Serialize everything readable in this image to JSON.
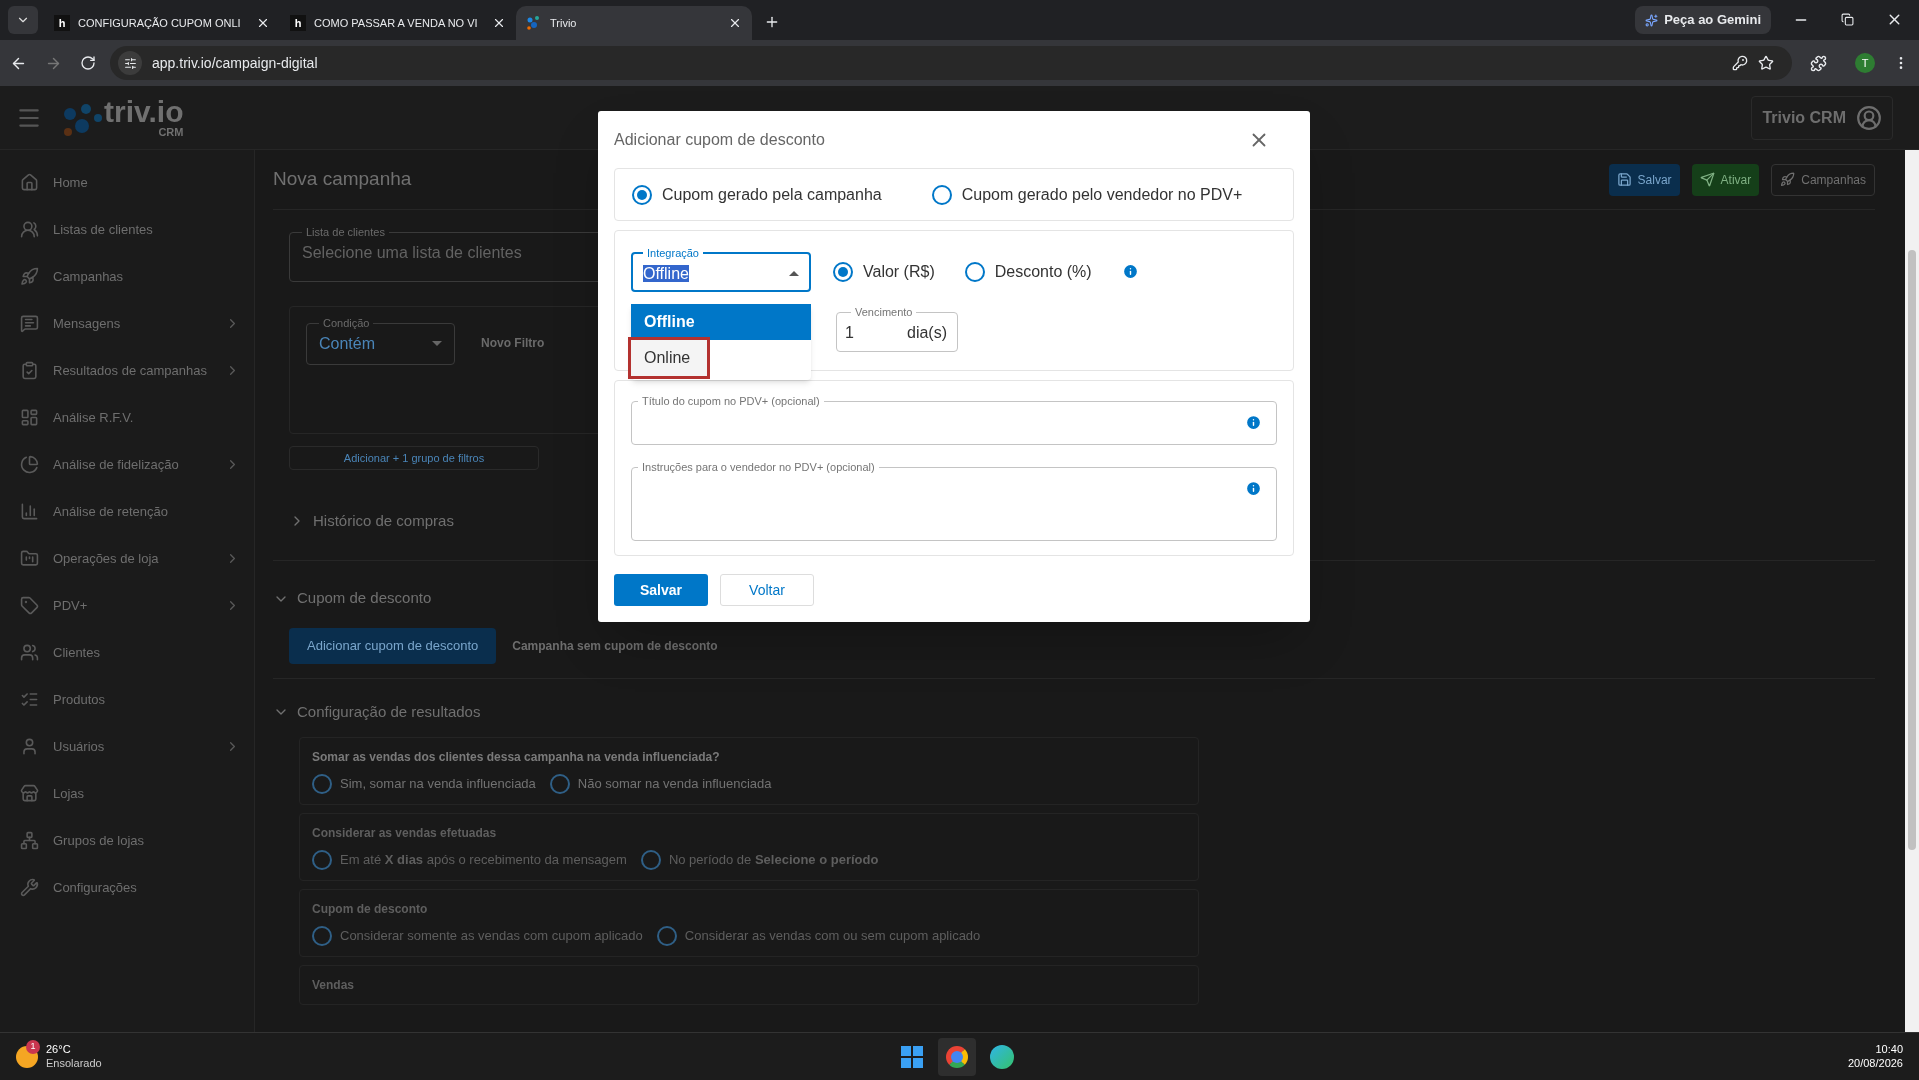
{
  "browser": {
    "tabs": [
      {
        "title": "CONFIGURAÇÃO CUPOM ONLI",
        "icon": "h",
        "selected": false
      },
      {
        "title": "COMO PASSAR A VENDA NO VI",
        "icon": "h",
        "selected": false
      },
      {
        "title": "Trivio",
        "selected": true
      }
    ],
    "url": "app.triv.io/campaign-digital",
    "gemini_button": "Peça ao Gemini",
    "profile_initial": "T"
  },
  "header": {
    "logo_text": "triv.io",
    "logo_sub": "CRM",
    "user_menu": "Trivio CRM"
  },
  "sidebar": {
    "items": [
      {
        "label": "Home",
        "expandable": false
      },
      {
        "label": "Listas de clientes",
        "expandable": false
      },
      {
        "label": "Campanhas",
        "expandable": false
      },
      {
        "label": "Mensagens",
        "expandable": true
      },
      {
        "label": "Resultados de campanhas",
        "expandable": true
      },
      {
        "label": "Análise R.F.V.",
        "expandable": false
      },
      {
        "label": "Análise de fidelização",
        "expandable": true
      },
      {
        "label": "Análise de retenção",
        "expandable": false
      },
      {
        "label": "Operações de loja",
        "expandable": true
      },
      {
        "label": "PDV+",
        "expandable": true
      },
      {
        "label": "Clientes",
        "expandable": false
      },
      {
        "label": "Produtos",
        "expandable": false
      },
      {
        "label": "Usuários",
        "expandable": true
      },
      {
        "label": "Lojas",
        "expandable": false
      },
      {
        "label": "Grupos de lojas",
        "expandable": false
      },
      {
        "label": "Configurações",
        "expandable": false
      }
    ]
  },
  "page": {
    "title": "Nova campanha",
    "actions": [
      {
        "label": "Salvar",
        "kind": "save"
      },
      {
        "label": "Ativar",
        "kind": "activate"
      },
      {
        "label": "Campanhas",
        "kind": "campaigns"
      }
    ],
    "client_list": {
      "label": "Lista de clientes",
      "placeholder": "Selecione uma lista de clientes"
    },
    "condition": {
      "label": "Condição",
      "value": "Contém"
    },
    "new_filter": "Novo Filtro",
    "add_group": "Adicionar + 1 grupo de filtros",
    "purchase_history": {
      "title": "Histórico de compras",
      "expanded": false
    },
    "coupon_section": {
      "title": "Cupom de desconto",
      "expanded": true,
      "add_button": "Adicionar cupom de desconto",
      "note": "Campanha sem cupom de desconto"
    },
    "results_section": {
      "title": "Configuração de resultados",
      "expanded": true,
      "groups": [
        {
          "title": "Somar as vendas dos clientes dessa campanha na venda influenciada?",
          "disabled": false,
          "options": [
            {
              "label": "Sim, somar na venda influenciada",
              "selected": false
            },
            {
              "label": "Não somar na venda influenciada",
              "selected": false
            }
          ]
        },
        {
          "title": "Considerar as vendas efetuadas",
          "disabled": true,
          "options": [
            {
              "label": "Em até **X dias** após o recebimento da mensagem",
              "selected": false
            },
            {
              "label": "No período de **Selecione o período**",
              "selected": false
            }
          ]
        },
        {
          "title": "Cupom de desconto",
          "disabled": true,
          "options": [
            {
              "label": "Considerar somente as vendas com cupom aplicado",
              "selected": false
            },
            {
              "label": "Considerar as vendas com ou sem cupom aplicado",
              "selected": false
            }
          ]
        },
        {
          "title": "Vendas",
          "disabled": true
        }
      ]
    }
  },
  "modal": {
    "title": "Adicionar cupom de desconto",
    "coupon_source": [
      {
        "label": "Cupom gerado pela campanha",
        "selected": true
      },
      {
        "label": "Cupom gerado pelo vendedor no PDV+",
        "selected": false
      }
    ],
    "integration": {
      "label": "Integração",
      "value": "Offline",
      "open": true,
      "options": [
        {
          "label": "Offline",
          "selected": true,
          "highlighted": false
        },
        {
          "label": "Online",
          "selected": false,
          "highlighted": true
        }
      ]
    },
    "value_type": [
      {
        "label": "Valor (R$)",
        "selected": true
      },
      {
        "label": "Desconto (%)",
        "selected": false
      }
    ],
    "expiry": {
      "label": "Vencimento",
      "value": "1",
      "unit": "dia(s)"
    },
    "title_field": {
      "label": "Título do cupom no PDV+ (opcional)"
    },
    "instructions_field": {
      "label": "Instruções para o vendedor no PDV+ (opcional)"
    },
    "buttons": [
      {
        "label": "Salvar",
        "kind": "primary"
      },
      {
        "label": "Voltar",
        "kind": "secondary"
      }
    ]
  },
  "taskbar": {
    "weather": {
      "temperature": "26°C",
      "condition": "Ensolarado",
      "badge": "1"
    },
    "clock": {
      "time": "10:40",
      "date": "20/08/2026"
    }
  }
}
